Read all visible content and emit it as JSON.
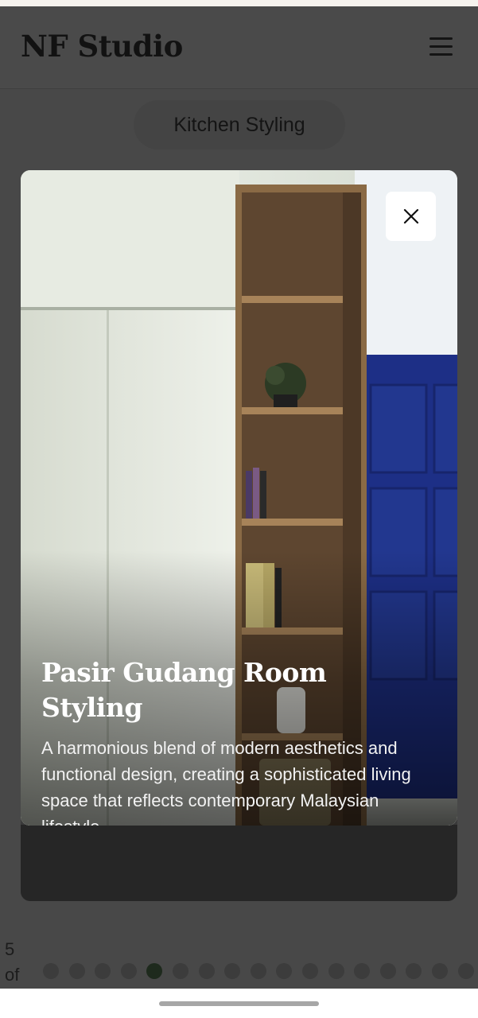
{
  "header": {
    "logo": "NF Studio",
    "menu_icon": "hamburger-menu-icon"
  },
  "category": {
    "label": "Kitchen Styling"
  },
  "gallery": {
    "counter_current": "5",
    "counter_of": "of",
    "total_dots": 17,
    "active_index": 4
  },
  "modal": {
    "title": "Pasir Gudang Room Styling",
    "description": "A harmonious blend of modern aesthetics and functional design, creating a sophisticated living space that reflects contemporary Malaysian lifestyle.",
    "close_icon": "close-icon"
  },
  "colors": {
    "overlay": "#484848",
    "door_blue": "#1d2f86",
    "shelf_wood": "#8a6a45"
  }
}
